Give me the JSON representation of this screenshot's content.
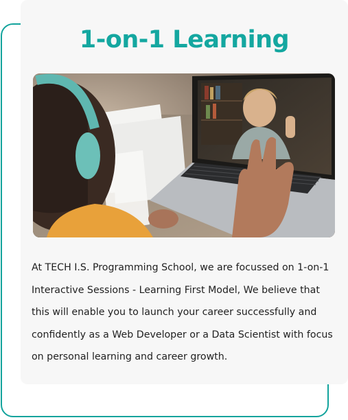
{
  "card": {
    "title": "1-on-1 Learning",
    "image_subject": "student-video-call-photo",
    "description": "At TECH I.S. Programming School, we are focussed on 1-on-1 Interactive Sessions -  Learning First Model,  We believe that this will enable you to launch your career successfully and confidently as a Web Developer or a Data Scientist with focus on personal learning and career growth."
  },
  "colors": {
    "accent": "#14a7a0",
    "card_background": "#f7f7f7",
    "body_text": "#1f1f1f"
  }
}
